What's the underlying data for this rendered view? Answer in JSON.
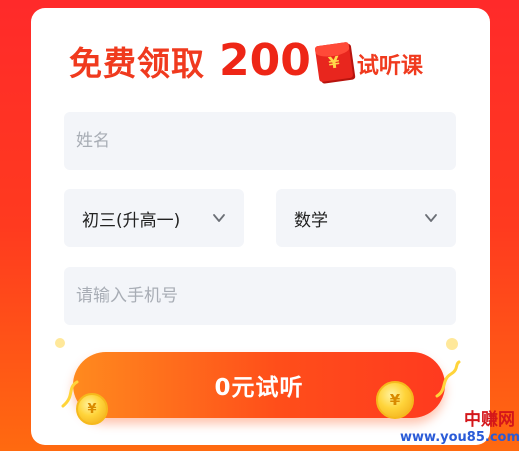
{
  "promo": {
    "title_main": "免费领取",
    "title_amount": "200",
    "title_suffix": "试听课",
    "envelope_symbol": "¥"
  },
  "form": {
    "name_placeholder": "姓名",
    "grade_value": "初三(升高一)",
    "subject_value": "数学",
    "phone_placeholder": "请输入手机号",
    "submit_label": "0元试听"
  },
  "decor": {
    "coin_symbol": "¥"
  },
  "watermark": {
    "brand": "中赚网",
    "url": "www.you85.com"
  },
  "colors": {
    "accent": "#f03a1e",
    "button_start": "#ff8a1e",
    "button_end": "#ff3a1f",
    "field_bg": "#f3f5f9"
  }
}
